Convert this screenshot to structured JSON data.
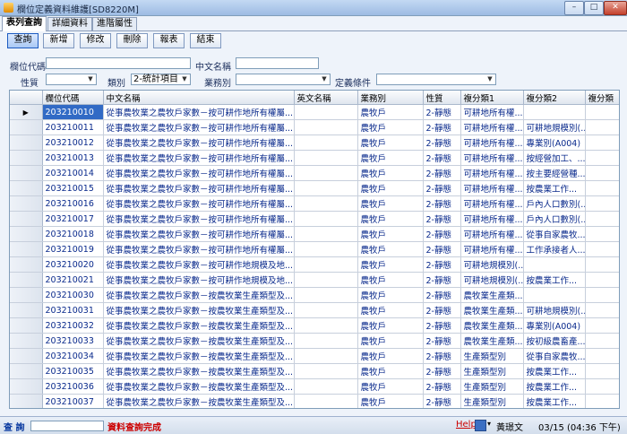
{
  "window": {
    "title": "欄位定義資料維護[SD8220M]",
    "min": "–",
    "max": "□",
    "close": "✕"
  },
  "tabs": [
    {
      "label": "表列查詢"
    },
    {
      "label": "詳細資料"
    },
    {
      "label": "進階屬性"
    }
  ],
  "toolbar": {
    "query": "查詢",
    "add": "新增",
    "edit": "修改",
    "delete": "刪除",
    "report": "報表",
    "exit": "結束"
  },
  "criteria": {
    "code_label": "欄位代碼",
    "code_value": "",
    "cname_label": "中文名稱",
    "cname_value": "",
    "nature_label": "性質",
    "nature_value": "",
    "category_label": "類別",
    "category_value": "2-統計項目",
    "business_label": "業務別",
    "business_value": "",
    "condition_label": "定義條件",
    "condition_value": ""
  },
  "grid": {
    "columns": [
      "欄位代碼",
      "中文名稱",
      "英文名稱",
      "業務別",
      "性質",
      "複分類1",
      "複分類2",
      "複分類"
    ],
    "rows": [
      {
        "code": "203210010",
        "cname": "從事農牧業之農牧戶家數－按可耕作地所有權屬...",
        "ename": "",
        "biz": "農牧戶",
        "nature": "2-靜態",
        "c1": "可耕地所有權...",
        "c2": ""
      },
      {
        "code": "203210011",
        "cname": "從事農牧業之農牧戶家數－按可耕作地所有權屬...",
        "ename": "",
        "biz": "農牧戶",
        "nature": "2-靜態",
        "c1": "可耕地所有權...",
        "c2": "可耕地規模別(..."
      },
      {
        "code": "203210012",
        "cname": "從事農牧業之農牧戶家數－按可耕作地所有權屬...",
        "ename": "",
        "biz": "農牧戶",
        "nature": "2-靜態",
        "c1": "可耕地所有權...",
        "c2": "專業別(A004)"
      },
      {
        "code": "203210013",
        "cname": "從事農牧業之農牧戶家數－按可耕作地所有權屬...",
        "ename": "",
        "biz": "農牧戶",
        "nature": "2-靜態",
        "c1": "可耕地所有權...",
        "c2": "按經營加工、..."
      },
      {
        "code": "203210014",
        "cname": "從事農牧業之農牧戶家數－按可耕作地所有權屬...",
        "ename": "",
        "biz": "農牧戶",
        "nature": "2-靜態",
        "c1": "可耕地所有權...",
        "c2": "按主要經營種..."
      },
      {
        "code": "203210015",
        "cname": "從事農牧業之農牧戶家數－按可耕作地所有權屬...",
        "ename": "",
        "biz": "農牧戶",
        "nature": "2-靜態",
        "c1": "可耕地所有權...",
        "c2": "按農業工作..."
      },
      {
        "code": "203210016",
        "cname": "從事農牧業之農牧戶家數－按可耕作地所有權屬...",
        "ename": "",
        "biz": "農牧戶",
        "nature": "2-靜態",
        "c1": "可耕地所有權...",
        "c2": "戶內人口數別(..."
      },
      {
        "code": "203210017",
        "cname": "從事農牧業之農牧戶家數－按可耕作地所有權屬...",
        "ename": "",
        "biz": "農牧戶",
        "nature": "2-靜態",
        "c1": "可耕地所有權...",
        "c2": "戶內人口數別(..."
      },
      {
        "code": "203210018",
        "cname": "從事農牧業之農牧戶家數－按可耕作地所有權屬...",
        "ename": "",
        "biz": "農牧戶",
        "nature": "2-靜態",
        "c1": "可耕地所有權...",
        "c2": "從事自家農牧..."
      },
      {
        "code": "203210019",
        "cname": "從事農牧業之農牧戶家數－按可耕作地所有權屬...",
        "ename": "",
        "biz": "農牧戶",
        "nature": "2-靜態",
        "c1": "可耕地所有權...",
        "c2": "工作承接者人..."
      },
      {
        "code": "203210020",
        "cname": "從事農牧業之農牧戶家數－按可耕作地規模及地...",
        "ename": "",
        "biz": "農牧戶",
        "nature": "2-靜態",
        "c1": "可耕地規模別(...",
        "c2": ""
      },
      {
        "code": "203210021",
        "cname": "從事農牧業之農牧戶家數－按可耕作地規模及地...",
        "ename": "",
        "biz": "農牧戶",
        "nature": "2-靜態",
        "c1": "可耕地規模別(...",
        "c2": "按農業工作..."
      },
      {
        "code": "203210030",
        "cname": "從事農牧業之農牧戶家數－按農牧業生產類型及...",
        "ename": "",
        "biz": "農牧戶",
        "nature": "2-靜態",
        "c1": "農牧業生產類...",
        "c2": ""
      },
      {
        "code": "203210031",
        "cname": "從事農牧業之農牧戶家數－按農牧業生產類型及...",
        "ename": "",
        "biz": "農牧戶",
        "nature": "2-靜態",
        "c1": "農牧業生產類...",
        "c2": "可耕地規模別(..."
      },
      {
        "code": "203210032",
        "cname": "從事農牧業之農牧戶家數－按農牧業生產類型及...",
        "ename": "",
        "biz": "農牧戶",
        "nature": "2-靜態",
        "c1": "農牧業生產類...",
        "c2": "專業別(A004)"
      },
      {
        "code": "203210033",
        "cname": "從事農牧業之農牧戶家數－按農牧業生產類型及...",
        "ename": "",
        "biz": "農牧戶",
        "nature": "2-靜態",
        "c1": "農牧業生產類...",
        "c2": "按初級農畜產..."
      },
      {
        "code": "203210034",
        "cname": "從事農牧業之農牧戶家數－按農牧業生產類型及...",
        "ename": "",
        "biz": "農牧戶",
        "nature": "2-靜態",
        "c1": "生產類型別",
        "c2": "從事自家農牧..."
      },
      {
        "code": "203210035",
        "cname": "從事農牧業之農牧戶家數－按農牧業生產類型及...",
        "ename": "",
        "biz": "農牧戶",
        "nature": "2-靜態",
        "c1": "生產類型別",
        "c2": "按農業工作..."
      },
      {
        "code": "203210036",
        "cname": "從事農牧業之農牧戶家數－按農牧業生產類型及...",
        "ename": "",
        "biz": "農牧戶",
        "nature": "2-靜態",
        "c1": "生產類型別",
        "c2": "按農業工作..."
      },
      {
        "code": "203210037",
        "cname": "從事農牧業之農牧戶家數－按農牧業生產類型及...",
        "ename": "",
        "biz": "農牧戶",
        "nature": "2-靜態",
        "c1": "生產類型別",
        "c2": "按農業工作..."
      }
    ]
  },
  "status": {
    "mode": "查 詢",
    "message": "資料查詢完成",
    "help": "Help",
    "dropdown": "▾",
    "user": "黃璟文",
    "time": "03/15 (04:36 下午)"
  },
  "colors": {
    "selection": "#316ac5",
    "text_blue": "#0a2a8c",
    "status_red": "#cc0000"
  }
}
